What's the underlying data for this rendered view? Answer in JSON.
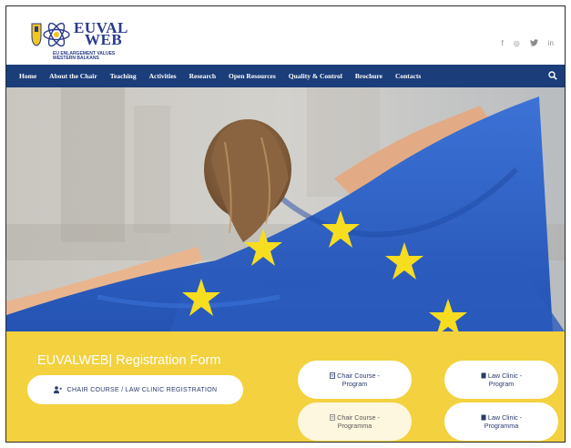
{
  "logo": {
    "word_line1": "EUVAL",
    "word_line2": "WEB",
    "tagline_line1": "EU ENLARGEMENT VALUES",
    "tagline_line2": "WESTERN BALKANS"
  },
  "socials": [
    {
      "icon": "facebook-icon",
      "glyph": "f"
    },
    {
      "icon": "instagram-icon",
      "glyph": "◎"
    },
    {
      "icon": "twitter-icon",
      "glyph": "♥"
    },
    {
      "icon": "linkedin-icon",
      "glyph": "in"
    }
  ],
  "nav": {
    "items": [
      "Home",
      "About the Chair",
      "Teaching",
      "Activities",
      "Research",
      "Open Resources",
      "Quality & Control",
      "Brochure",
      "Contacts"
    ],
    "search_icon": "search-icon"
  },
  "hero": {
    "image": "woman-holding-eu-flag"
  },
  "band": {
    "form_title": "EUVALWEB| Registration Form",
    "register_button": "CHAIR COURSE / LAW CLINIC REGISTRATION",
    "register_icon": "user-plus-icon",
    "links": [
      {
        "line1": "Chair Course -",
        "line2": "Program",
        "icon": "document-icon"
      },
      {
        "line1": "Law Clinic -",
        "line2": "Program",
        "icon": "document-icon"
      },
      {
        "line1": "Chair Course -",
        "line2": "Programma",
        "icon": "document-icon"
      },
      {
        "line1": "Law Clinic -",
        "line2": "Programma",
        "icon": "document-icon"
      }
    ]
  },
  "colors": {
    "nav_bg": "#1b3d7a",
    "band_bg": "#f3d13f",
    "brand_blue": "#2a3a8c",
    "flag_blue": "#2f63c9",
    "star_yellow": "#f7dd1f"
  }
}
